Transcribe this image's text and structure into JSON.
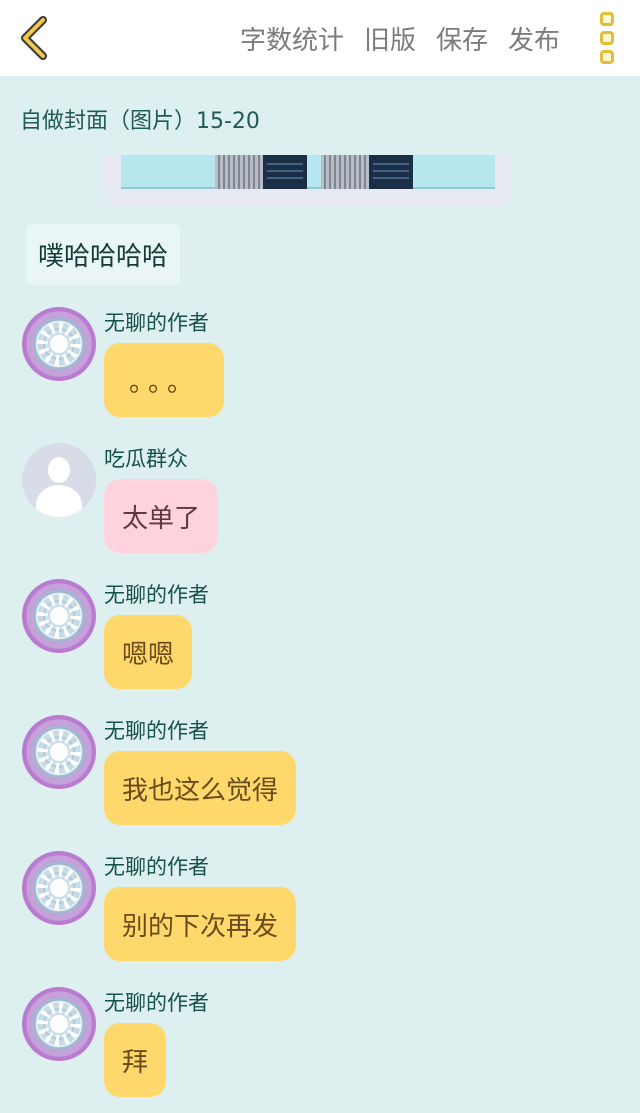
{
  "toolbar": {
    "actions": [
      "字数统计",
      "旧版",
      "保存",
      "发布"
    ]
  },
  "section": {
    "title": "自做封面（图片）15-20"
  },
  "narration": "噗哈哈哈哈",
  "messages": [
    {
      "author": "无聊的作者",
      "text": "。。。",
      "color": "#ffd86b"
    },
    {
      "author": "吃瓜群众",
      "text": "太单了",
      "color": "#ffd3de"
    },
    {
      "author": "无聊的作者",
      "text": "嗯嗯",
      "color": "#ffd86b"
    },
    {
      "author": "无聊的作者",
      "text": "我也这么觉得",
      "color": "#ffd86b"
    },
    {
      "author": "无聊的作者",
      "text": "别的下次再发",
      "color": "#ffd86b"
    },
    {
      "author": "无聊的作者",
      "text": "拜",
      "color": "#ffd86b"
    }
  ],
  "icons": {
    "back": "chevron-left-icon",
    "more": "more-vertical-icon",
    "author_avatar": "flower-avatar",
    "reader_avatar": "default-person-avatar"
  },
  "colors": {
    "background": "#ddf0ef",
    "accent": "#e4bd3b",
    "author_bubble": "#ffd86b",
    "reader_bubble": "#ffd3de"
  }
}
